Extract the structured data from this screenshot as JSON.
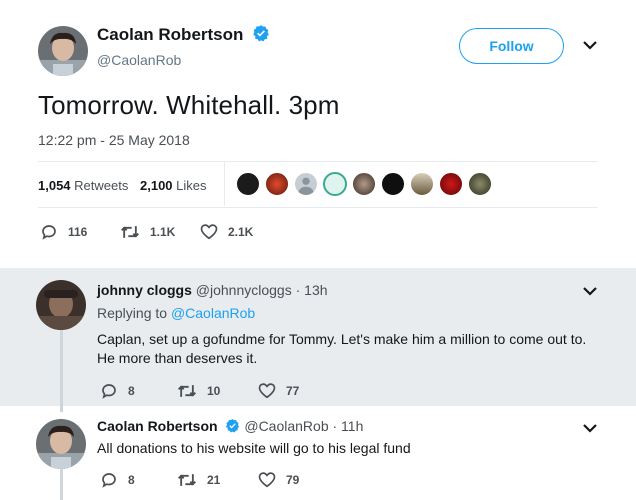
{
  "main_tweet": {
    "author_name": "Caolan Robertson",
    "author_handle": "@CaolanRob",
    "follow_label": "Follow",
    "text": "Tomorrow. Whitehall. 3pm",
    "timestamp": "12:22 pm - 25 May 2018",
    "retweets_count": "1,054",
    "retweets_label": "Retweets",
    "likes_count": "2,100",
    "likes_label": "Likes",
    "actions": {
      "replies": "116",
      "retweets": "1.1K",
      "likes": "2.1K"
    }
  },
  "replies": [
    {
      "author_name": "johnny cloggs",
      "author_handle": "@johnnycloggs · 13h",
      "replying_prefix": "Replying to",
      "replying_to": "@CaolanRob",
      "text_line1": "Caplan, set up a gofundme for Tommy.  Let's make him a million to come out to.",
      "text_line2": "He more than deserves it.",
      "actions": {
        "replies": "8",
        "retweets": "10",
        "likes": "77"
      }
    },
    {
      "author_name": "Caolan Robertson",
      "author_handle": "@CaolanRob · 11h",
      "text_line1": "All donations to his website will go to his legal fund",
      "actions": {
        "replies": "8",
        "retweets": "21",
        "likes": "79"
      }
    }
  ],
  "colors": {
    "accent": "#1da1f2",
    "reply_bg": "#e8ecef",
    "muted": "#657786"
  }
}
